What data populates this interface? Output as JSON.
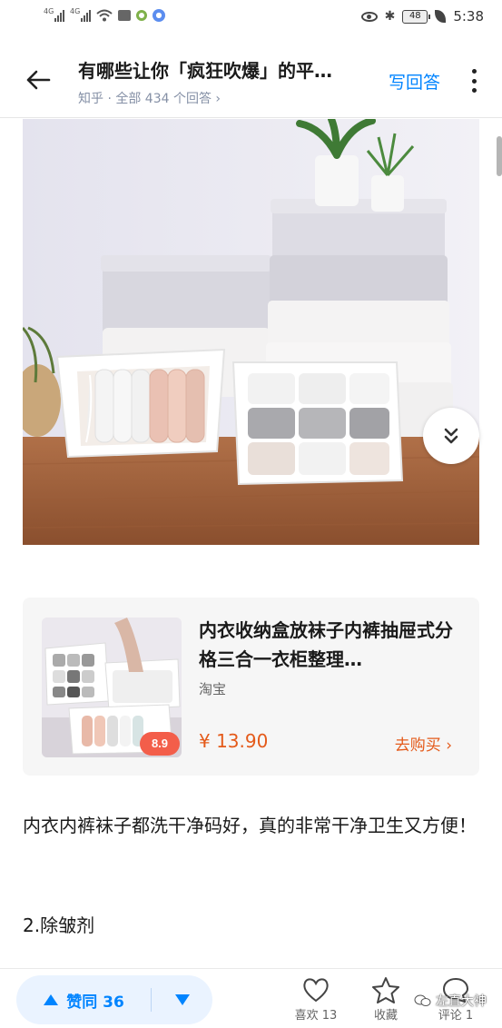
{
  "status_bar": {
    "signal1_tag": "4G",
    "signal2_tag": "4G",
    "battery": "48",
    "time": "5:38"
  },
  "header": {
    "title": "有哪些让你「疯狂吹爆」的平…",
    "meta": "知乎 · 全部 434 个回答 ›",
    "write_answer": "写回答"
  },
  "product": {
    "title": "内衣收纳盒放袜子内裤抽屉式分格三合一衣柜整理…",
    "source": "淘宝",
    "price": "¥ 13.90",
    "buy_label": "去购买 ›",
    "thumb_badge": "8.9"
  },
  "content": {
    "paragraph": "内衣内裤袜子都洗干净码好，真的非常干净卫生又方便！",
    "section_heading": "2.除皱剂"
  },
  "bottom_bar": {
    "vote_label": "赞同 36",
    "like_label": "喜欢 13",
    "collect_label": "收藏",
    "comment_label": "评论 1",
    "watermark": "左直大神"
  },
  "colors": {
    "accent": "#0084ff",
    "price": "#e45a1a",
    "vote_bg": "#eaf3ff"
  }
}
